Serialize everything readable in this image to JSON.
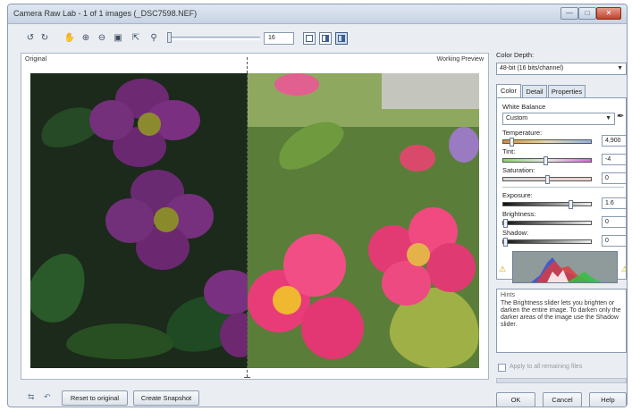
{
  "window": {
    "title": "Camera Raw Lab - 1 of 1 images (_DSC7598.NEF)"
  },
  "toolbar": {
    "zoom_value": "16",
    "icons": [
      "rotate-left-icon",
      "rotate-right-icon",
      "hand-icon",
      "zoom-in-icon",
      "zoom-out-icon",
      "fit-to-window-icon",
      "actual-size-icon",
      "magnifier-icon"
    ],
    "view_modes": [
      "single-view",
      "split-view",
      "split-horizontal-view"
    ],
    "active_view": "split-horizontal-view"
  },
  "preview": {
    "original_label": "Original",
    "working_label": "Working Preview"
  },
  "bottom": {
    "reset_label": "Reset to original",
    "snapshot_label": "Create Snapshot",
    "ok_label": "OK",
    "cancel_label": "Cancel",
    "help_label": "Help"
  },
  "panel": {
    "color_depth_label": "Color Depth:",
    "color_depth_value": "48-bit (16 bits/channel)",
    "tabs": [
      "Color",
      "Detail",
      "Properties"
    ],
    "active_tab": "Color",
    "white_balance_label": "White Balance",
    "white_balance_value": "Custom",
    "temperature_label": "Temperature:",
    "temperature_value": "4,900",
    "temperature_level": 0.08,
    "tint_label": "Tint:",
    "tint_value": "-4",
    "tint_level": 0.48,
    "saturation_label": "Saturation:",
    "saturation_value": "0",
    "saturation_level": 0.5,
    "exposure_label": "Exposure:",
    "exposure_value": "1.6",
    "exposure_level": 0.78,
    "brightness_label": "Brightness:",
    "brightness_value": "0",
    "brightness_level": 0.0,
    "shadow_label": "Shadow:",
    "shadow_value": "0",
    "shadow_level": 0.0,
    "hints_title": "Hints",
    "hints_text": "The Brightness slider lets you brighten or darken the entire image. To darken only the darker areas of the image use the Shadow slider.",
    "apply_all_label": "Apply to all remaining files",
    "apply_all_checked": false
  }
}
